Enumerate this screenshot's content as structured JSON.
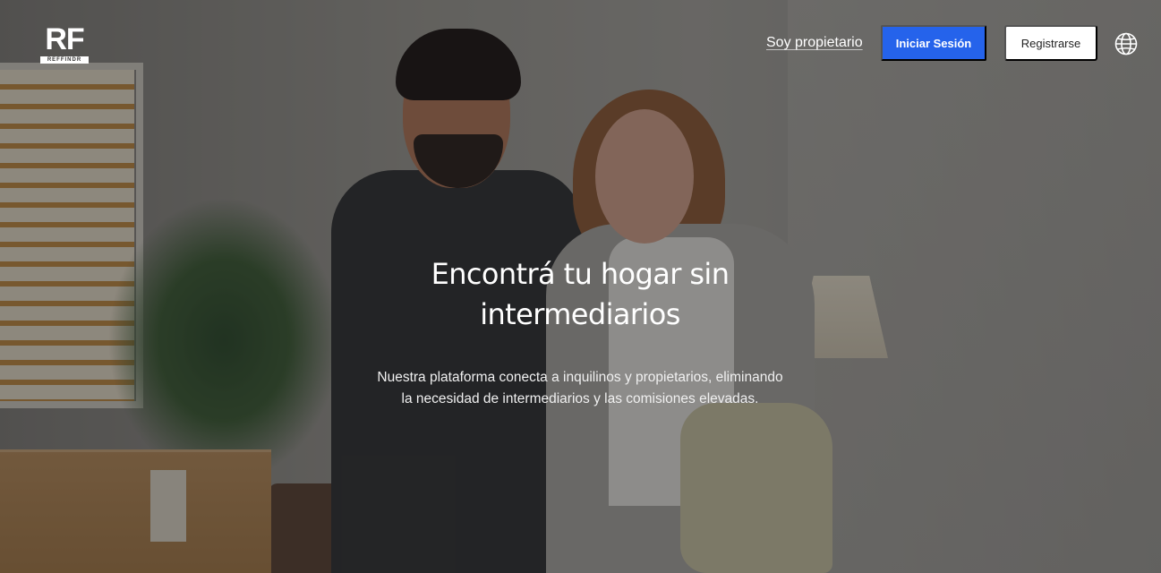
{
  "brand": {
    "logo_letters": "RF",
    "logo_tagline": "REFFINDR"
  },
  "nav": {
    "owner_link": "Soy propietario",
    "login_button": "Iniciar Sesión",
    "register_button": "Registrarse",
    "language_icon": "globe-icon"
  },
  "hero": {
    "headline_line1": "Encontrá tu hogar sin",
    "headline_line2": "intermediarios",
    "subtitle_line1": "Nuestra plataforma conecta a inquilinos y propietarios, eliminando",
    "subtitle_line2": "la necesidad de intermediarios y las comisiones elevadas."
  },
  "colors": {
    "primary": "#2563eb",
    "white": "#ffffff"
  }
}
